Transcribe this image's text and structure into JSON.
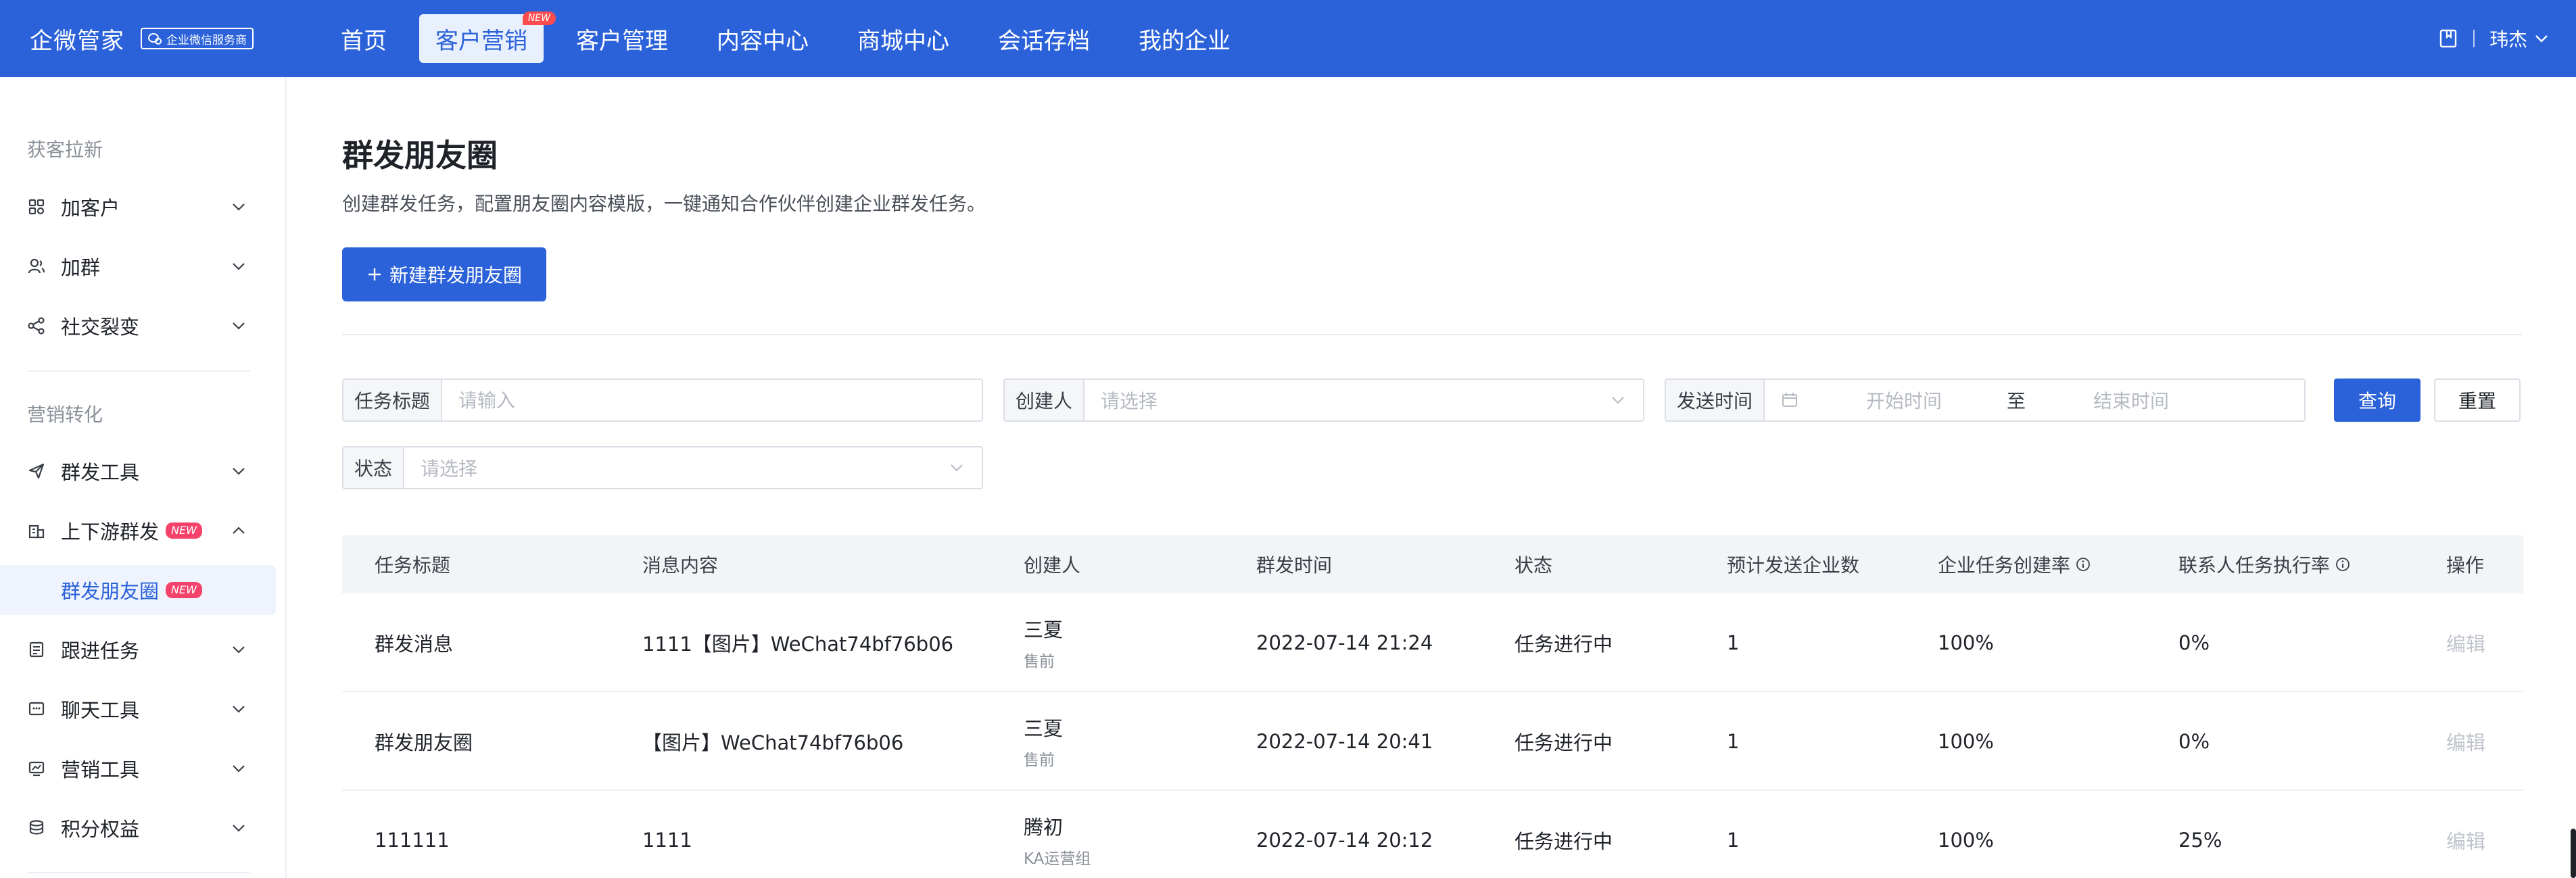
{
  "brand": {
    "name": "企微管家",
    "badge": "企业微信服务商"
  },
  "nav": {
    "items": [
      {
        "label": "首页"
      },
      {
        "label": "客户营销",
        "badge": "NEW",
        "active": true
      },
      {
        "label": "客户管理"
      },
      {
        "label": "内容中心"
      },
      {
        "label": "商城中心"
      },
      {
        "label": "会话存档"
      },
      {
        "label": "我的企业"
      }
    ],
    "user": "玮杰"
  },
  "sidebar": {
    "section1": "获客拉新",
    "section2": "营销转化",
    "items": [
      {
        "label": "加客户",
        "icon": "grid-icon"
      },
      {
        "label": "加群",
        "icon": "user-group-icon"
      },
      {
        "label": "社交裂变",
        "icon": "share-icon"
      },
      {
        "label": "群发工具",
        "icon": "send-icon"
      },
      {
        "label": "上下游群发",
        "icon": "building-icon",
        "badge": "NEW",
        "expanded": true
      },
      {
        "label": "群发朋友圈",
        "badge": "NEW",
        "selected": true
      },
      {
        "label": "跟进任务",
        "icon": "task-icon"
      },
      {
        "label": "聊天工具",
        "icon": "chat-icon"
      },
      {
        "label": "营销工具",
        "icon": "chart-icon"
      },
      {
        "label": "积分权益",
        "icon": "coins-icon"
      }
    ]
  },
  "page": {
    "title": "群发朋友圈",
    "description": "创建群发任务，配置朋友圈内容模版，一键通知合作伙伴创建企业群发任务。",
    "create_button": "新建群发朋友圈"
  },
  "filters": {
    "task_title": {
      "label": "任务标题",
      "placeholder": "请输入"
    },
    "creator": {
      "label": "创建人",
      "placeholder": "请选择"
    },
    "send_time": {
      "label": "发送时间",
      "start_placeholder": "开始时间",
      "separator": "至",
      "end_placeholder": "结束时间"
    },
    "status": {
      "label": "状态",
      "placeholder": "请选择"
    },
    "query_button": "查询",
    "reset_button": "重置"
  },
  "table": {
    "headers": [
      "任务标题",
      "消息内容",
      "创建人",
      "群发时间",
      "状态",
      "预计发送企业数",
      "企业任务创建率",
      "联系人任务执行率",
      "操作"
    ],
    "rows": [
      {
        "title": "群发消息",
        "content": "1111【图片】WeChat74bf76b06",
        "creator": "三夏",
        "dept": "售前",
        "time": "2022-07-14 21:24",
        "status": "任务进行中",
        "count": "1",
        "create_rate": "100%",
        "exec_rate": "0%",
        "action": "编辑"
      },
      {
        "title": "群发朋友圈",
        "content": "【图片】WeChat74bf76b06",
        "creator": "三夏",
        "dept": "售前",
        "time": "2022-07-14 20:41",
        "status": "任务进行中",
        "count": "1",
        "create_rate": "100%",
        "exec_rate": "0%",
        "action": "编辑"
      },
      {
        "title": "111111",
        "content": "1111",
        "creator": "腾初",
        "dept": "KA运营组",
        "time": "2022-07-14 20:12",
        "status": "任务进行中",
        "count": "1",
        "create_rate": "100%",
        "exec_rate": "25%",
        "action": "编辑"
      }
    ]
  },
  "colors": {
    "primary": "#2b62d9",
    "badge_red": "#f5426b",
    "nav_active_bg": "#e8effd"
  }
}
